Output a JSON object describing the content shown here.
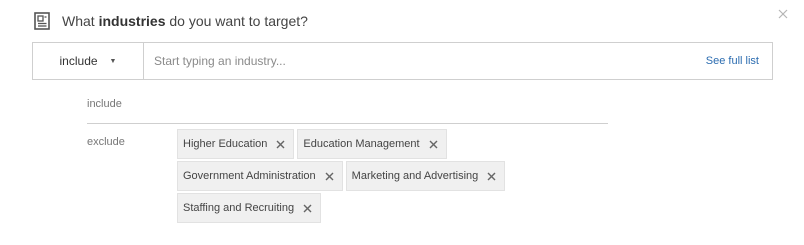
{
  "header": {
    "prefix": "What",
    "emphasis": "industries",
    "suffix": "do you want to target?",
    "icon": "list-document-icon"
  },
  "search": {
    "mode_value": "include",
    "placeholder": "Start typing an industry...",
    "see_full_list": "See full list"
  },
  "include": {
    "label": "include"
  },
  "exclude": {
    "label": "exclude",
    "tags": [
      "Higher Education",
      "Education Management",
      "Government Administration",
      "Marketing and Advertising",
      "Staffing and Recruiting"
    ]
  },
  "colors": {
    "link": "#2b6cb0",
    "tag_bg": "#f0f0f0",
    "border": "#cfcfcf"
  }
}
